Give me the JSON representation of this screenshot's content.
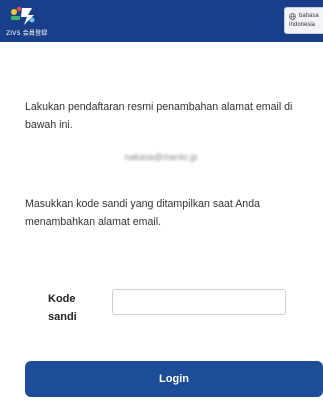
{
  "header": {
    "logo_text": "ZIVS 会員登録",
    "language_button": {
      "line1": "bahasa",
      "line2": "Indonesia"
    }
  },
  "form": {
    "instruction": "Lakukan pendaftaran resmi penambahan alamat email di bawah ini.",
    "email": "nakasa@manto.jp",
    "password_instruction": "Masukkan kode sandi yang ditampilkan saat Anda menambahkan alamat email.",
    "password_label": "Kode sandi",
    "password_value": "",
    "login_label": "Login"
  },
  "colors": {
    "header_bg": "#1a3f8a",
    "button_bg": "#1d4d97"
  },
  "icons": {
    "logo": "ziv-logo-icon",
    "language": "globe-icon"
  }
}
